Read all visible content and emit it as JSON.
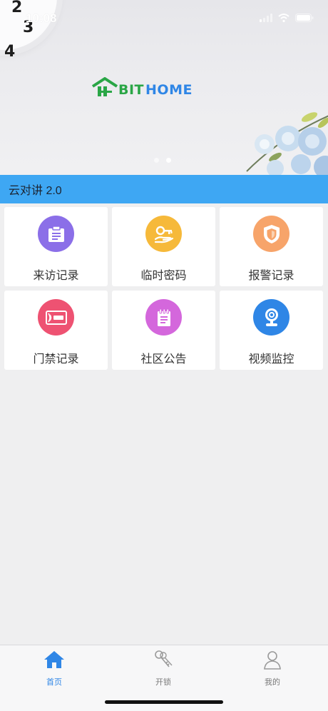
{
  "status_bar": {
    "time": "10:08"
  },
  "banner": {
    "clock_numbers": [
      "2",
      "3",
      "4"
    ],
    "logo": {
      "prefix": "BIT",
      "suffix": "HOME"
    },
    "carousel_pages": 2,
    "carousel_active": 1
  },
  "header": {
    "title": "云对讲 2.0"
  },
  "grid": [
    {
      "label": "来访记录",
      "color": "#8b6fe8",
      "icon": "clipboard-icon"
    },
    {
      "label": "临时密码",
      "color": "#f6b93a",
      "icon": "key-hand-icon"
    },
    {
      "label": "报警记录",
      "color": "#f7a46a",
      "icon": "shield-icon"
    },
    {
      "label": "门禁记录",
      "color": "#ee5272",
      "icon": "access-card-icon"
    },
    {
      "label": "社区公告",
      "color": "#d467dc",
      "icon": "notepad-icon"
    },
    {
      "label": "视频监控",
      "color": "#2f86e6",
      "icon": "webcam-icon"
    }
  ],
  "tabs": [
    {
      "label": "首页",
      "icon": "home-icon",
      "active": true
    },
    {
      "label": "开锁",
      "icon": "keys-icon",
      "active": false
    },
    {
      "label": "我的",
      "icon": "user-icon",
      "active": false
    }
  ],
  "colors": {
    "accent": "#3ea7f3",
    "tab_active": "#2f86e6",
    "logo_green": "#2aa646",
    "logo_blue": "#2f86e6"
  }
}
